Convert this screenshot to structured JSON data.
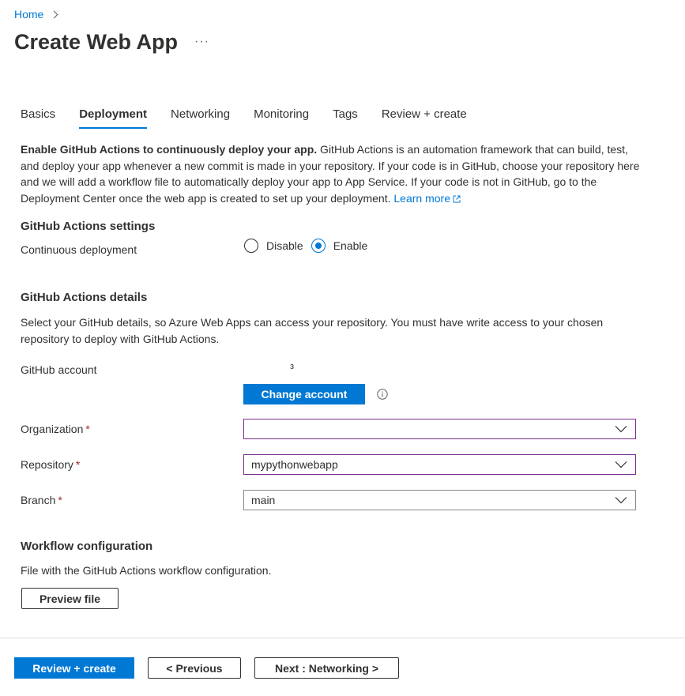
{
  "breadcrumb": {
    "home": "Home"
  },
  "page": {
    "title": "Create Web App",
    "more": "···"
  },
  "tabs": [
    {
      "label": "Basics"
    },
    {
      "label": "Deployment"
    },
    {
      "label": "Networking"
    },
    {
      "label": "Monitoring"
    },
    {
      "label": "Tags"
    },
    {
      "label": "Review + create"
    }
  ],
  "active_tab": "Deployment",
  "intro": {
    "bold": "Enable GitHub Actions to continuously deploy your app.",
    "text": " GitHub Actions is an automation framework that can build, test, and deploy your app whenever a new commit is made in your repository. If your code is in GitHub, choose your repository here and we will add a workflow file to automatically deploy your app to App Service. If your code is not in GitHub, go to the Deployment Center once the web app is created to set up your deployment. ",
    "learn_more": "Learn more"
  },
  "settings": {
    "heading": "GitHub Actions settings",
    "cd_label": "Continuous deployment",
    "options": [
      "Disable",
      "Enable"
    ],
    "selected": "Enable"
  },
  "details": {
    "heading": "GitHub Actions details",
    "description": "Select your GitHub details, so Azure Web Apps can access your repository. You must have write access to your chosen repository to deploy with GitHub Actions.",
    "account_label": "GitHub account",
    "account_value": "з",
    "change_account": "Change account",
    "organization_label": "Organization",
    "organization_value": "",
    "repository_label": "Repository",
    "repository_value": "mypythonwebapp",
    "branch_label": "Branch",
    "branch_value": "main",
    "required_mark": "*"
  },
  "workflow": {
    "heading": "Workflow configuration",
    "description": "File with the GitHub Actions workflow configuration.",
    "preview": "Preview file"
  },
  "footer": {
    "review": "Review + create",
    "previous": "< Previous",
    "next": "Next : Networking >"
  },
  "colors": {
    "accent": "#0078d4",
    "text": "#323130",
    "required": "#a4262c",
    "invalid_border": "#7a2e8e"
  }
}
